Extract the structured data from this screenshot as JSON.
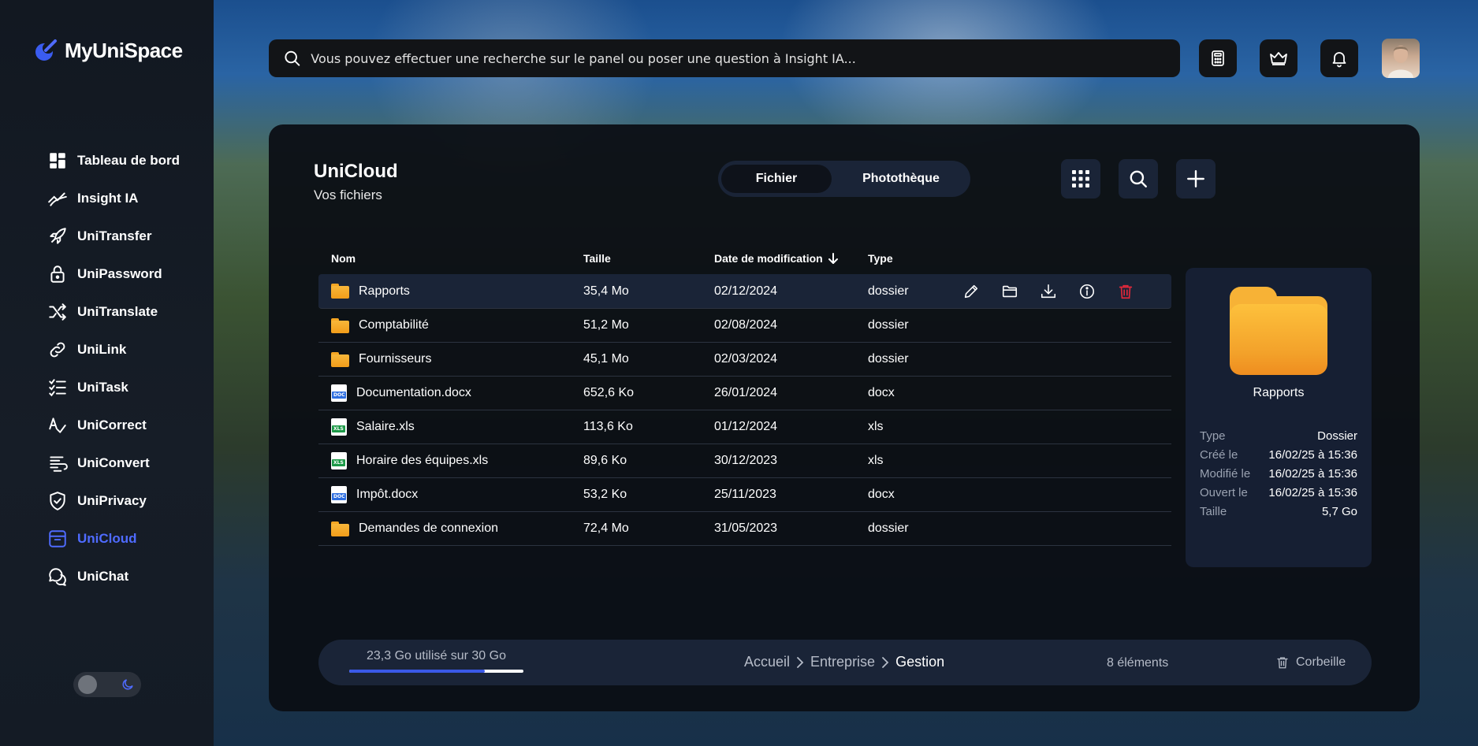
{
  "app": {
    "name": "MyUniSpace"
  },
  "sidebar": {
    "items": [
      {
        "label": "Tableau de bord",
        "icon": "dashboard-icon"
      },
      {
        "label": "Insight IA",
        "icon": "insight-icon"
      },
      {
        "label": "UniTransfer",
        "icon": "rocket-icon"
      },
      {
        "label": "UniPassword",
        "icon": "lock-icon"
      },
      {
        "label": "UniTranslate",
        "icon": "shuffle-icon"
      },
      {
        "label": "UniLink",
        "icon": "link-icon"
      },
      {
        "label": "UniTask",
        "icon": "tasklist-icon"
      },
      {
        "label": "UniCorrect",
        "icon": "correct-icon"
      },
      {
        "label": "UniConvert",
        "icon": "convert-icon"
      },
      {
        "label": "UniPrivacy",
        "icon": "shield-icon"
      },
      {
        "label": "UniCloud",
        "icon": "archive-icon",
        "active": true
      },
      {
        "label": "UniChat",
        "icon": "chat-icon"
      }
    ],
    "active_color": "#4f6bff"
  },
  "search": {
    "placeholder": "Vous pouvez effectuer une recherche sur le panel ou poser une question à Insight IA..."
  },
  "header_icons": [
    "calculator-icon",
    "crown-icon",
    "bell-icon"
  ],
  "panel": {
    "title": "UniCloud",
    "subtitle": "Vos fichiers",
    "tabs": [
      {
        "label": "Fichier",
        "active": true
      },
      {
        "label": "Photothèque",
        "active": false
      }
    ],
    "tools": [
      "grid-icon",
      "search-icon",
      "plus-icon"
    ]
  },
  "table": {
    "columns": {
      "name": "Nom",
      "size": "Taille",
      "date": "Date de modification",
      "type": "Type"
    },
    "rows": [
      {
        "name": "Rapports",
        "size": "35,4 Mo",
        "date": "02/12/2024",
        "type": "dossier",
        "kind": "folder",
        "selected": true
      },
      {
        "name": "Comptabilité",
        "size": "51,2 Mo",
        "date": "02/08/2024",
        "type": "dossier",
        "kind": "folder"
      },
      {
        "name": "Fournisseurs",
        "size": "45,1 Mo",
        "date": "02/03/2024",
        "type": "dossier",
        "kind": "folder"
      },
      {
        "name": "Documentation.docx",
        "size": "652,6 Ko",
        "date": "26/01/2024",
        "type": "docx",
        "kind": "docx"
      },
      {
        "name": "Salaire.xls",
        "size": "113,6 Ko",
        "date": "01/12/2024",
        "type": "xls",
        "kind": "xls"
      },
      {
        "name": "Horaire des équipes.xls",
        "size": "89,6 Ko",
        "date": "30/12/2023",
        "type": "xls",
        "kind": "xls"
      },
      {
        "name": "Impôt.docx",
        "size": "53,2 Ko",
        "date": "25/11/2023",
        "type": "docx",
        "kind": "docx"
      },
      {
        "name": "Demandes de connexion",
        "size": "72,4 Mo",
        "date": "31/05/2023",
        "type": "dossier",
        "kind": "folder"
      }
    ],
    "row_actions": [
      "pencil-icon",
      "folder-open-icon",
      "download-icon",
      "info-icon",
      "trash-icon"
    ]
  },
  "details": {
    "name": "Rapports",
    "props": [
      {
        "key": "Type",
        "value": "Dossier"
      },
      {
        "key": "Créé le",
        "value": "16/02/25 à 15:36"
      },
      {
        "key": "Modifié le",
        "value": "16/02/25 à 15:36"
      },
      {
        "key": "Ouvert le",
        "value": "16/02/25 à 15:36"
      },
      {
        "key": "Taille",
        "value": "5,7 Go"
      }
    ]
  },
  "footer": {
    "storage_label": "23,3 Go utilisé sur 30 Go",
    "storage_used_fraction": 0.78,
    "breadcrumb": [
      "Accueil",
      "Entreprise",
      "Gestion"
    ],
    "count": "8 éléments",
    "trash_label": "Corbeille"
  }
}
